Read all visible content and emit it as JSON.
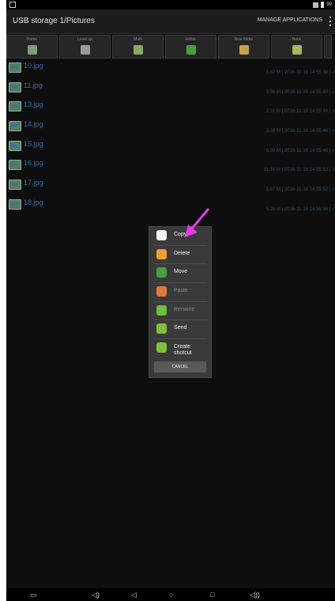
{
  "statusbar": {
    "time": "99"
  },
  "titlebar": {
    "title": "USB storage 1/Pictures",
    "manage": "MANAGE APPLICATIONS"
  },
  "toolbar": {
    "buttons": [
      {
        "label": "Home",
        "icon": "home-icon",
        "color": "#7f9a7f"
      },
      {
        "label": "Level up",
        "icon": "level-up-icon",
        "color": "#9a9a9a"
      },
      {
        "label": "Multi",
        "icon": "multi-icon",
        "color": "#8ca86a"
      },
      {
        "label": "Editor",
        "icon": "editor-icon",
        "color": "#4b9e3e"
      },
      {
        "label": "New folder",
        "icon": "new-folder-icon",
        "color": "#c8a14a"
      },
      {
        "label": "Back",
        "icon": "back-icon",
        "color": "#a6b85a"
      }
    ]
  },
  "files": [
    {
      "name": "10.jpg",
      "meta": "3.62 M | 2016-11-16 14:55:38 | -r"
    },
    {
      "name": "11.jpg",
      "meta": "3.96 M | 2016-11-16 14:55:40 | -r"
    },
    {
      "name": "13.jpg",
      "meta": "2.91 M | 2016-11-16 14:55:44 | -r"
    },
    {
      "name": "14.jpg",
      "meta": "3.39 M | 2016-11-16 14:55:46 | -r"
    },
    {
      "name": "15.jpg",
      "meta": "6.30 M | 2016-11-16 14:55:48 | -r"
    },
    {
      "name": "16.jpg",
      "meta": "11.16 M | 2016-11-16 14:55:52 | -r"
    },
    {
      "name": "17.jpg",
      "meta": "2.67 M | 2016-11-16 14:55:52 | -r"
    },
    {
      "name": "18.jpg",
      "meta": "5.28 M | 2016-11-16 14:55:56 | -r"
    }
  ],
  "menu": {
    "items": [
      {
        "label": "Copy",
        "icon": "copy-icon",
        "color": "#f2f2f2",
        "enabled": true
      },
      {
        "label": "Delete",
        "icon": "delete-icon",
        "color": "#f0a030",
        "enabled": true
      },
      {
        "label": "Move",
        "icon": "move-icon",
        "color": "#46a046",
        "enabled": true
      },
      {
        "label": "Paste",
        "icon": "paste-icon",
        "color": "#e07a3a",
        "enabled": false
      },
      {
        "label": "Rename",
        "icon": "rename-icon",
        "color": "#6abf3e",
        "enabled": false
      },
      {
        "label": "Send",
        "icon": "send-icon",
        "color": "#7fbf3f",
        "enabled": true
      },
      {
        "label": "Create shotcut",
        "icon": "pin-icon",
        "color": "#7fc33a",
        "enabled": true
      }
    ],
    "cancel": "CANCEL"
  },
  "annotation_color": "#e83ae8",
  "navbar": {
    "buttons": [
      "screenshot-icon",
      "volume-down-icon",
      "back-icon",
      "home-icon",
      "recents-icon",
      "volume-up-icon"
    ]
  }
}
